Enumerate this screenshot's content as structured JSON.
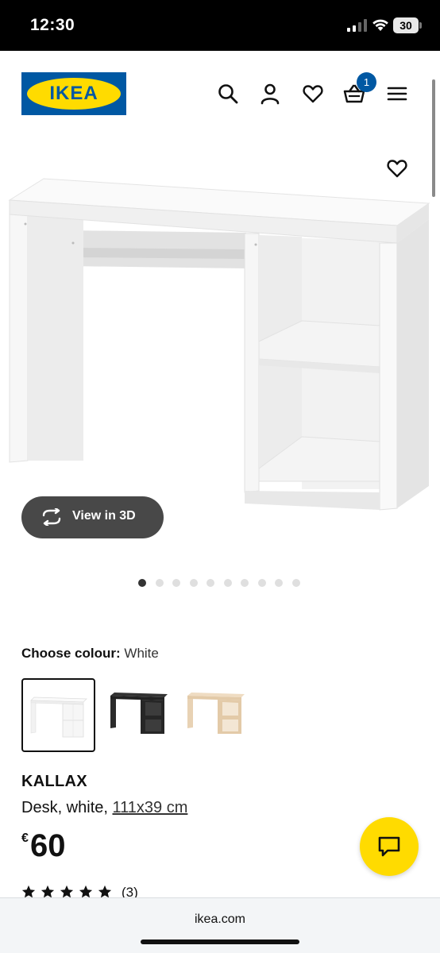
{
  "status_bar": {
    "time": "12:30",
    "battery_level": "30"
  },
  "header": {
    "logo_text": "IKEA",
    "cart_count": "1",
    "icons": [
      "search-icon",
      "user-icon",
      "heart-icon",
      "basket-icon",
      "menu-icon"
    ]
  },
  "product": {
    "view_3d_label": "View in 3D",
    "image_count": 10,
    "active_image_index": 0,
    "colour_label": "Choose colour:",
    "colour_value": "White",
    "swatches": [
      {
        "name": "white",
        "selected": true,
        "color": "#ffffff"
      },
      {
        "name": "black-brown",
        "selected": false,
        "color": "#2a2a2a"
      },
      {
        "name": "white-stained-oak",
        "selected": false,
        "color": "#e8d2b4"
      }
    ],
    "name": "KALLAX",
    "description": "Desk, white,",
    "dimensions": "111x39 cm",
    "currency": "€",
    "price": "60",
    "rating_stars": 5,
    "review_count": "(3)"
  },
  "browser": {
    "url": "ikea.com"
  },
  "colors": {
    "brand_blue": "#0058a3",
    "brand_yellow": "#ffdb00",
    "button_dark": "#484848"
  }
}
